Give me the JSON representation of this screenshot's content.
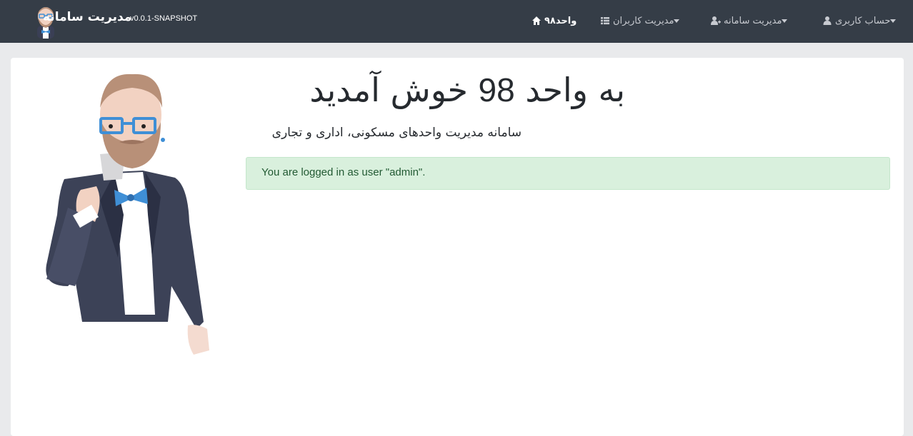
{
  "navbar": {
    "brand_title": "مدیریت سامانه",
    "brand_version": "v0.0.1-SNAPSHOT",
    "items": [
      {
        "label": "واحد۹۸",
        "icon": "home-icon",
        "active": true
      },
      {
        "label": "مدیریت کاربران",
        "icon": "list-icon",
        "has_dropdown": true
      },
      {
        "label": "مدیریت سامانه",
        "icon": "user-plus-icon",
        "has_dropdown": true
      },
      {
        "label": "حساب کاربری",
        "icon": "user-icon",
        "has_dropdown": true
      }
    ]
  },
  "main": {
    "title_prefix": "به واحد",
    "title_number": "98",
    "title_suffix": "خوش آمدید",
    "subtitle": "سامانه مدیریت واحدهای مسکونی، اداری و تجاری",
    "alert": "You are logged in as user \"admin\"."
  },
  "colors": {
    "navbar_bg": "#353d47",
    "page_bg": "#e9eaec",
    "alert_bg": "#d9f0dd",
    "alert_text": "#225a33"
  }
}
